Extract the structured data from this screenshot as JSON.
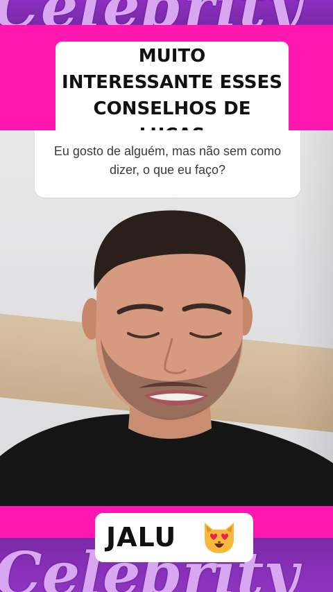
{
  "brand": {
    "script_text": "Celebrity"
  },
  "title": {
    "line1": "MUITO",
    "line2": "INTERESSANTE ESSES",
    "line3": "CONSELHOS DE",
    "line4": "LUCAS"
  },
  "question": {
    "text": "Eu gosto de alguém, mas não sem como dizer, o que eu faço?"
  },
  "caption": {
    "name": "JALU",
    "emoji": "smiling-cat-heart-eyes-icon"
  },
  "colors": {
    "pink_band": "#ff17b0",
    "purple": "#7a2aa8",
    "script": "#d9a6f2"
  }
}
